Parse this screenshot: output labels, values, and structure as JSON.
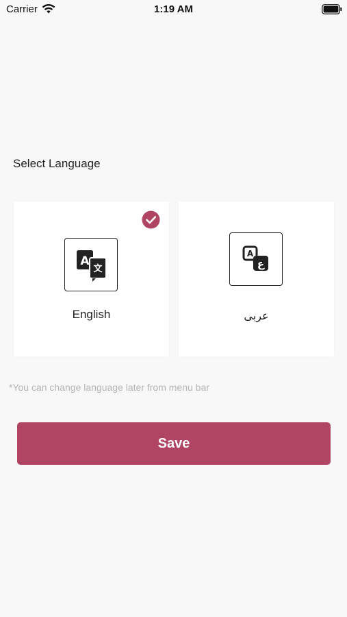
{
  "status_bar": {
    "carrier": "Carrier",
    "time": "1:19 AM",
    "wifi_icon": "wifi-icon",
    "battery_icon": "battery-icon"
  },
  "section_title": "Select Language",
  "languages": [
    {
      "label": "English",
      "icon": "translate-icon",
      "selected": true
    },
    {
      "label": "عربى",
      "icon": "arabic-translate-icon",
      "selected": false
    }
  ],
  "hint": "*You can change language later from menu bar",
  "save_label": "Save",
  "colors": {
    "accent": "#b04463",
    "background": "#f8f8f8",
    "card": "#ffffff",
    "hint_text": "#b5b5b5"
  }
}
